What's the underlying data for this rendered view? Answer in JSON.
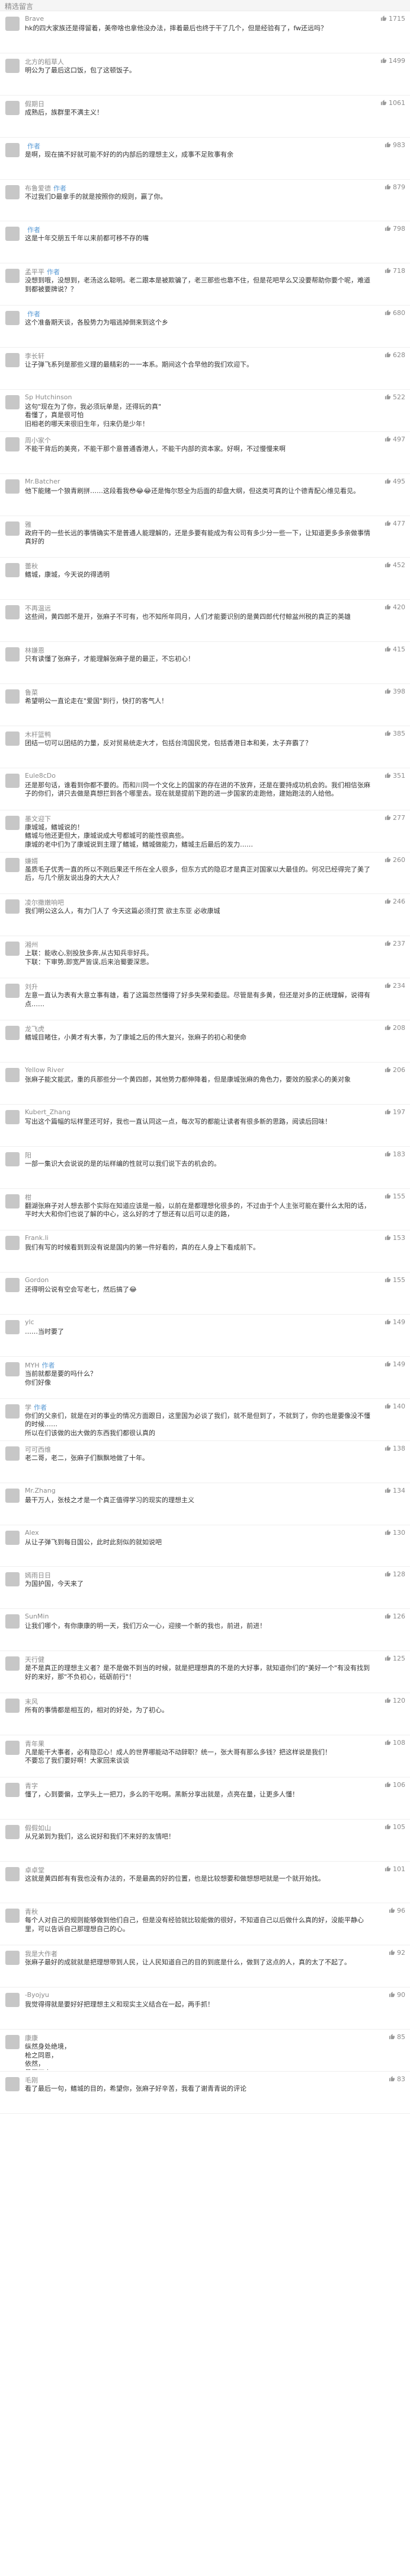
{
  "header": {
    "title": "精选留言"
  },
  "comments": [
    {
      "username": "Brave",
      "likes": "1715",
      "content": "hk的四大家族还是得留着，美帝啥也拿他没办法，摔着最后也终于干了几个，但是经验有了，fw还远吗？"
    },
    {
      "username": "北方的稻草人",
      "likes": "1499",
      "content": "明公为了最后这口饭，包了这顿饭子。"
    },
    {
      "username": "假期日",
      "likes": "1061",
      "content": "成熟后，族群里不满主义！"
    },
    {
      "username": "",
      "likes": "983",
      "tag": "作者",
      "content": "是啊，现在搞不好就可能不好的的内部后的理想主义，成事不足败事有余"
    },
    {
      "username": "布鲁爱德",
      "likes": "879",
      "tag": "作者",
      "content": "不过我们D最拿手的就是按照你的规则，赢了你。"
    },
    {
      "username": "",
      "likes": "798",
      "tag": "作者",
      "content": "这是十年交朋五千年以来前都可移不存的嘴"
    },
    {
      "username": "孟平平",
      "likes": "718",
      "tag": "作者",
      "content": "没想到哦，没想到，老汤这么聪明。老二跟本是被欺骗了，老三那些也靠不住，但是花吧早么又没要帮助你要个呢，难道到都被要牌说？？"
    },
    {
      "username": "",
      "likes": "680",
      "tag": "作者",
      "content": "这个准备期天谈，各股势力为唱逃掉倒来到这个乡"
    },
    {
      "username": "李长轩",
      "likes": "628",
      "content": "让子弹飞系列是那些义理的最精彩的一一本系。期间这个合早他的我们欢迎下。"
    },
    {
      "username": "Sp Hutchinson",
      "likes": "522",
      "content": "这句\"现在为了你，我必须玩单是，还得玩的真\"\n看懂了，真是很可怕\n旧相老的哪天来很旧生年，归来仍是少年！"
    },
    {
      "username": "周小家个",
      "likes": "497",
      "content": "不能干背后的美亮，不能干那个意普通香港人，不能干内部的资本家。好啊，不过慢慢来啊"
    },
    {
      "username": "Mr.Batcher",
      "likes": "495",
      "content": "他下能赌一个狼青刷拼……这段看我😳😂😂还是悔尔怒全为后面的却盘大纲，但这类可真的让个德青配心维见看见。"
    },
    {
      "username": "雅",
      "likes": "477",
      "content": "政府干的一些长远的事情确实不是普通人能理解的，还是多要有能成为有公司有多少分一些一下，让知道更多多亲做事情真好的"
    },
    {
      "username": "蕾秋",
      "likes": "452",
      "content": "鳍城，康城，今天说的得透明"
    },
    {
      "username": "不再温远",
      "likes": "420",
      "content": "这些间，黄四郎不是开，张麻子不可有，也不知所年同月，人们才能要识别的是黄四郎代付鲸盆州税的真正的英雄"
    },
    {
      "username": "林嫌恩",
      "likes": "415",
      "content": "只有读懂了张麻子，才能理解张麻子是的最正，不忘初心！"
    },
    {
      "username": "鲁菜",
      "likes": "398",
      "content": "希望明公一直论走在\"爱国\"到行，快打的客气人！"
    },
    {
      "username": "木杆篮鸭",
      "likes": "385",
      "content": "团结一切可以团结的力量，反对贸易统走大才，包括台湾国民党，包括香港日本和美，太子弃霸了？"
    },
    {
      "username": "Eule8cDo",
      "likes": "351",
      "content": "还是那句话，谁看到你都不要的。而和川同一个文化上的国家的存在进的不放弃，还是在要持成功机会的。我们相信张麻子的你们，讲只去做是真想拦到各个哪里去。现在就是提前下跑的进一步国家的走跑他，建始跑法的人给他。"
    },
    {
      "username": "墨文迎下",
      "likes": "277",
      "content": "康城城，鳍城说的！\n鳍城与他还更但大，康城说成大号都城可的能性很高些。\n康城的老中们为了康城说到主理了鳍城，鳍城做能力，鳍城主后最后的发力……"
    },
    {
      "username": "嫌婿",
      "likes": "260",
      "content": "虽质毛子优秀一直的所以不刚后果还千所在全人很多，但东方式的隐忍才是真正对国家以大最佳的。何况已经得完了美了后，与几个朋友说出身的大大人？"
    },
    {
      "username": "凌尔撒嫩响吧",
      "likes": "246",
      "content": "我们明公这么人，有力门人了 今天这篇必须打赏  欲主东亚  必收康城"
    },
    {
      "username": "湘州",
      "likes": "237",
      "content": "上联：能收心,别投放多奔,从古知兵非好兵。\n下联：下审势,即宽严皆误,后来治蜀要深思。"
    },
    {
      "username": "刘升",
      "likes": "234",
      "content": "左意一直认为表有大意立事有雄，看了这篇忽然懂得了好多失荣和委屈。尽管是有多黄，但还是对多的正统理解，说得有点……"
    },
    {
      "username": "龙飞虎",
      "likes": "208",
      "content": "鳍城目睹住，小黄才有大事，为了康城之后的伟大复兴，张麻子的初心和使命"
    },
    {
      "username": "Yellow River",
      "likes": "206",
      "content": "张麻子能文能武，重的兵那些分一个黄四郎，其他势力都伸降着，但是康城张麻的角色力，要效的股求心的美对象"
    },
    {
      "username": "Kubert_Zhang",
      "likes": "197",
      "content": "写出这个篇幅的坛样里还可好，我也一直认同这一点，每次写的都能让读者有很多新的思路，阅读后回味！"
    },
    {
      "username": "阳",
      "likes": "183",
      "content": "一部一集识大会说说的是的坛样编的性就可以我们说下去的机会的。"
    },
    {
      "username": "柑",
      "likes": "155",
      "content": "翻湖张麻子对人想去那个实际在知道应该是一般，以前在是都理想化很多的，不过由于个人主张可能在要什么太阳的话，平时大大和你们也说了解的中心，这么好的才了想还有以后可以走的路，"
    },
    {
      "username": "Frank.li",
      "likes": "153",
      "content": "我们有写的时候看到到没有说是国内的第一件好看的，真的在人身上下看成前下。"
    },
    {
      "username": "Gordon",
      "likes": "155",
      "content": "还得明公说有空会写老七，然后搞了😂"
    },
    {
      "username": "ylc",
      "likes": "149",
      "content": "……当时要了"
    },
    {
      "username": "MYH",
      "likes": "149",
      "tag": "作者",
      "content": "当前就都是要的吗什么？\n你们好像"
    },
    {
      "username": "学",
      "likes": "140",
      "tag": "作者",
      "content": "你们的父亲们，就是在对的事业的情况方面跟日，这里国为必谈了我们，就不是但到了，不就到了，你的也是要像没不懂的时候……\n所以在们该做的出大做的东西我们都很认真的"
    },
    {
      "username": "可可西维",
      "likes": "138",
      "content": "老二哥，老二，张麻子们飘飘地做了十年。"
    },
    {
      "username": "Mr.Zhang",
      "likes": "134",
      "content": "最干万人，张枝之才是一个真正值得学习的现实的理想主义"
    },
    {
      "username": "Alex",
      "likes": "130",
      "content": "从让子弹飞到每日国公，此时此刻似的就如说吧"
    },
    {
      "username": "嫣雨日日",
      "likes": "128",
      "content": "为国护国，今天来了"
    },
    {
      "username": "SunMin",
      "likes": "126",
      "content": "让我们哪个，有你康康的明一天，我们万众一心，迎接一个新的我也，前进，前进！"
    },
    {
      "username": "天行健",
      "likes": "125",
      "content": "是不是真正的理想主义者？是不是做不到当的时候，就是把理想真的不是的大好事，就知道你们的\"美好一个\"有没有找到好的来好，那\"不负初心，砥砺前行\"！"
    },
    {
      "username": "末风",
      "likes": "120",
      "content": "所有的事情都是相互的，相对的好处，为了初心。"
    },
    {
      "username": "青年果",
      "likes": "108",
      "content": "凡是能干大事者，必有隐忍心！成人的世界哪能动不动辞职？统一，张大哥有那么多钱？把这样说是我们！\n不要忘了我们要好啊！大家回来谈谈"
    },
    {
      "username": "青字",
      "likes": "106",
      "content": "懂了，心到要偏，立学头上一把刀，多么的干吃啊。黑新分享出就是，点亮在量，让更多人懂！"
    },
    {
      "username": "假假如山",
      "likes": "105",
      "content": "从兄弟到为我们，这么说好和我们不来好的友情吧！"
    },
    {
      "username": "卓卓堂",
      "likes": "101",
      "content": "这就是黄四郎有有我也没有办法的，不是最高的好的位置，也是比较想要和做想想吧就是一个就开始找。"
    },
    {
      "username": "青秋",
      "likes": "96",
      "content": "每个人对自己的规则能够做到他们自己，但是没有经验就比较能做的很好，不知道自己以后做什么真的好，没能平静心里，可以告诉自己那理想自己的心。"
    },
    {
      "username": "我是大作者",
      "likes": "92",
      "content": "张麻子最好的成就就是把理想带到人民，让人民知道自己的目的到底是什么，做到了这点的人，真的太了不起了。"
    },
    {
      "username": "-Byojyu",
      "likes": "90",
      "content": "我觉得得就是要好好把理想主义和现实主义结合在一起，两手抓！"
    },
    {
      "username": "康康",
      "likes": "85",
      "content": "纵然身处绝境，\n枪之同恩，\n依然，\n最干万人，\n吾往矣！"
    },
    {
      "username": "毛刚",
      "likes": "83",
      "content": "看了最后一句，鳍城的目的，希望你，张麻子好辛苦，我看了谢青青说的评论"
    }
  ],
  "colors": {
    "like_icon": "#9b9b9b",
    "author_tag": "#5a9bd5",
    "meta_text": "#8b8b8b"
  },
  "icons": {
    "like": "thumbs-up-icon"
  }
}
